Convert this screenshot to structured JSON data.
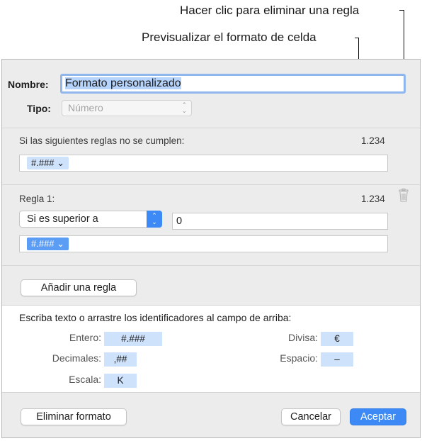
{
  "callouts": {
    "delete_rule": "Hacer clic para eliminar una regla",
    "preview_format": "Previsualizar el formato de celda"
  },
  "dialog": {
    "name_label": "Nombre:",
    "name_value": "Formato personalizado",
    "type_label": "Tipo:",
    "type_value": "Número",
    "default_section": {
      "label": "Si las siguientes reglas no se cumplen:",
      "preview": "1.234",
      "token": "#.### ⌄"
    },
    "rule": {
      "label": "Regla 1:",
      "preview": "1.234",
      "condition": "Si es superior a",
      "value": "0",
      "token": "#.### ⌄"
    },
    "add_rule_button": "Añadir una regla",
    "identifiers": {
      "instructions": "Escriba texto o arrastre los identificadores al campo de arriba:",
      "integer_label": "Entero:",
      "integer_token": "#.###",
      "decimals_label": "Decimales:",
      "decimals_token": ",##",
      "scale_label": "Escala:",
      "scale_token": "K",
      "currency_label": "Divisa:",
      "currency_token": "€",
      "space_label": "Espacio:",
      "space_token": "–"
    },
    "buttons": {
      "delete_format": "Eliminar formato",
      "cancel": "Cancelar",
      "accept": "Aceptar"
    }
  },
  "colors": {
    "accent": "#3d8af7",
    "token_light": "#cfe2fb",
    "focus_ring": "#8fb7ee"
  }
}
